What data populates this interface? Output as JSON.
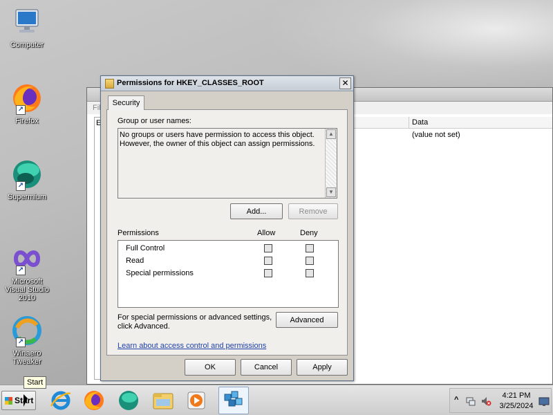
{
  "desktop": {
    "icons": [
      {
        "label": "Computer",
        "icon": "computer-icon"
      },
      {
        "label": "Firefox",
        "icon": "firefox-icon"
      },
      {
        "label": "Supermium",
        "icon": "supermium-icon"
      },
      {
        "label": "Microsoft Visual Studio 2010",
        "icon": "visual-studio-icon"
      },
      {
        "label": "Winaero Tweaker",
        "icon": "winaero-tweaker-icon"
      }
    ]
  },
  "background_window": {
    "menu_fragment": "Fil",
    "tree_fragment": "E",
    "column_data": "Data",
    "row_value": "(value not set)"
  },
  "dialog": {
    "title": "Permissions for HKEY_CLASSES_ROOT",
    "close": "✕",
    "tab": "Security",
    "group_label": "Group or user names:",
    "group_message_line1": "No groups or users have permission to access this object.",
    "group_message_line2": "However, the owner of this object can assign permissions.",
    "add_button": "Add...",
    "remove_button": "Remove",
    "permissions_header": "Permissions",
    "allow_header": "Allow",
    "deny_header": "Deny",
    "permissions": [
      {
        "name": "Full Control",
        "allow": false,
        "deny": false
      },
      {
        "name": "Read",
        "allow": false,
        "deny": false
      },
      {
        "name": "Special permissions",
        "allow": false,
        "deny": false
      }
    ],
    "advanced_text_line1": "For special permissions or advanced settings,",
    "advanced_text_line2": "click Advanced.",
    "advanced_button": "Advanced",
    "help_link": "Learn about access control and permissions",
    "ok_button": "OK",
    "cancel_button": "Cancel",
    "apply_button": "Apply"
  },
  "taskbar": {
    "start_label": "Start",
    "tooltip": "Start",
    "apps": [
      "internet-explorer-icon",
      "firefox-icon",
      "supermium-icon",
      "file-explorer-icon",
      "media-player-icon",
      "regedit-icon"
    ],
    "clock_time": "4:21 PM",
    "clock_date": "3/25/2024",
    "tray_chevron": "^"
  },
  "colors": {
    "dialog_bg": "#d4d0c8",
    "link": "#1f3fa8",
    "titlebar": "#c6cdd6"
  }
}
